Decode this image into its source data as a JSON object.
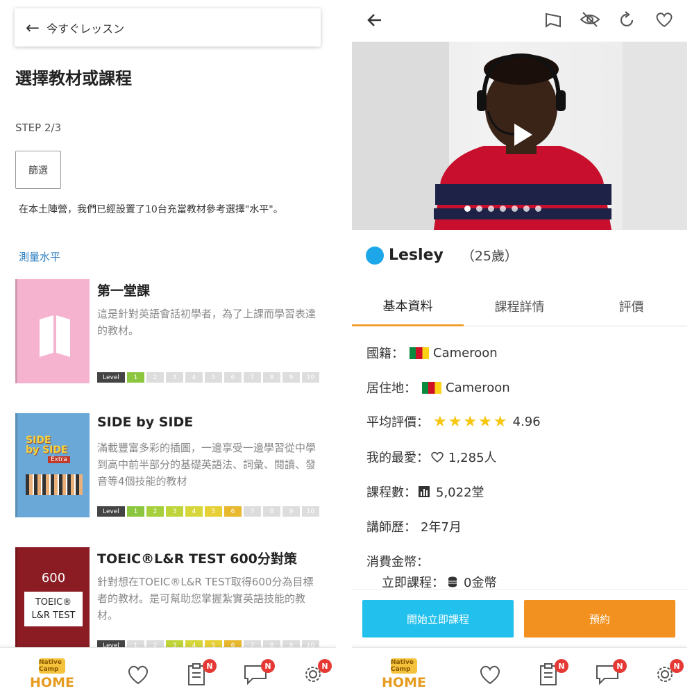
{
  "left": {
    "searchbar": {
      "text": "今すぐレッスン"
    },
    "page_title": "選擇教材或課程",
    "step": "STEP 2/3",
    "filter_label": "篩選",
    "note": "在本土陣營，我們已經設置了10台充當教材參考選擇\"水平\"。",
    "measure_link": "測量水平",
    "level_label": "Level",
    "books": [
      {
        "title": "第一堂課",
        "desc": "這是針對英語會話初學者，為了上課而學習表達的教材。",
        "levels_active": 1
      },
      {
        "title": "SIDE by SIDE",
        "desc": "滿載豐富多彩的插圖，一邊享受一邊學習從中學到高中前半部分的基礎英語法、詞彙、閱讀、發音等4個技能的教材",
        "levels_active": 6,
        "cover_text": [
          "SIDE",
          "by SIDE",
          "Extra"
        ]
      },
      {
        "title": "TOEIC®L&R TEST 600分對策",
        "desc": "針對想在TOEIC®L&R TEST取得600分為目標者的教材。是可幫助您掌握紮實英語技能的教材。",
        "levels_active": 6,
        "cover_text": [
          "600",
          "TOEIC®",
          "L&R TEST"
        ]
      }
    ],
    "level_numbers": [
      "1",
      "2",
      "3",
      "4",
      "5",
      "6",
      "7",
      "8",
      "9",
      "10"
    ]
  },
  "tabbar": {
    "home_label": "HOME",
    "logo_text": "Native Camp",
    "badge": "N"
  },
  "right": {
    "teacher": {
      "name": "Lesley",
      "age": "（25歲）"
    },
    "tabs": [
      "基本資料",
      "課程詳情",
      "評價"
    ],
    "info": {
      "nationality_label": "國籍：",
      "nationality": "Cameroon",
      "residence_label": "居住地：",
      "residence": "Cameroon",
      "rating_label": "平均評價：",
      "rating": "4.96",
      "stars": "★★★★★",
      "favorites_label": "我的最愛：",
      "favorites": "1,285人",
      "lessons_label": "課程數：",
      "lessons": "5,022堂",
      "experience_label": "講師歷：",
      "experience": "2年7月",
      "coins_label": "消費金幣：",
      "instant_label": "立即課程：",
      "instant_value": "0金幣"
    },
    "buttons": {
      "start_now": "開始立即課程",
      "book": "預約"
    }
  },
  "colors": {
    "accent_orange": "#f29120",
    "accent_blue": "#22c0ec",
    "link_blue": "#2d7fc1",
    "badge_red": "#e53935"
  }
}
